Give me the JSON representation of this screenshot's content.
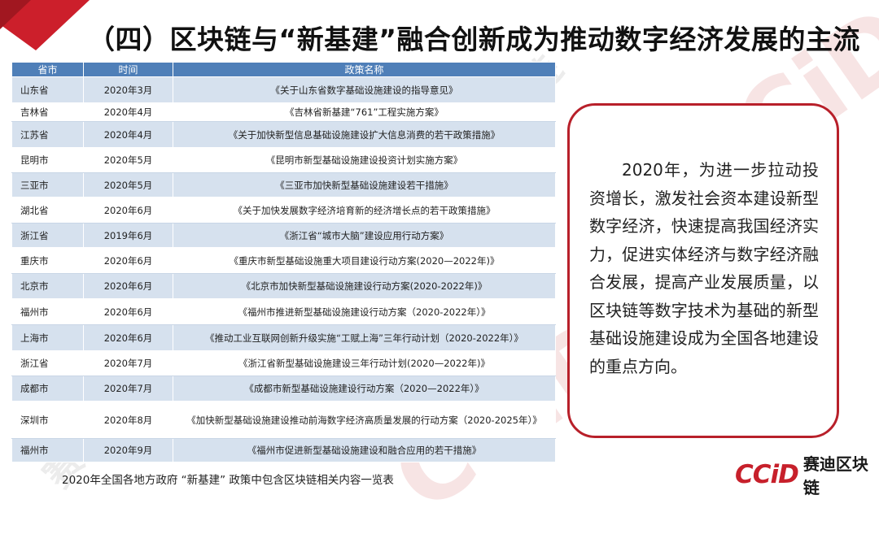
{
  "title": "（四）区块链与“新基建”融合创新成为推动数字经济发展的主流",
  "colors": {
    "accent": "#c7202b",
    "header": "#4f7fb8",
    "row_alt": "#d6e1ee"
  },
  "watermarks": {
    "logo": "CCiD",
    "text": "赛迪区块链"
  },
  "table": {
    "headers": [
      "省市",
      "时间",
      "政策名称"
    ],
    "rows": [
      {
        "region": "山东省",
        "date": "2020年3月",
        "policy": "《关于山东省数字基础设施建设的指导意见》"
      },
      {
        "region": "吉林省",
        "date": "2020年4月",
        "policy": "《吉林省新基建“761”工程实施方案》"
      },
      {
        "region": "江苏省",
        "date": "2020年4月",
        "policy": "《关于加快新型信息基础设施建设扩大信息消费的若干政策措施》"
      },
      {
        "region": "昆明市",
        "date": "2020年5月",
        "policy": "《昆明市新型基础设施建设投资计划实施方案》"
      },
      {
        "region": "三亚市",
        "date": "2020年5月",
        "policy": "《三亚市加快新型基础设施建设若干措施》"
      },
      {
        "region": "湖北省",
        "date": "2020年6月",
        "policy": "《关于加快发展数字经济培育新的经济增长点的若干政策措施》"
      },
      {
        "region": "浙江省",
        "date": "2019年6月",
        "policy": "《浙江省“城市大脑”建设应用行动方案》"
      },
      {
        "region": "重庆市",
        "date": "2020年6月",
        "policy": "《重庆市新型基础设施重大项目建设行动方案(2020—2022年)》"
      },
      {
        "region": "北京市",
        "date": "2020年6月",
        "policy": "《北京市加快新型基础设施建设行动方案(2020-2022年)》"
      },
      {
        "region": "福州市",
        "date": "2020年6月",
        "policy": "《福州市推进新型基础设施建设行动方案（2020-2022年）》"
      },
      {
        "region": "上海市",
        "date": "2020年6月",
        "policy": "《推动工业互联网创新升级实施“工赋上海”三年行动计划（2020-2022年）》"
      },
      {
        "region": "浙江省",
        "date": "2020年7月",
        "policy": "《浙江省新型基础设施建设三年行动计划(2020—2022年)》"
      },
      {
        "region": "成都市",
        "date": "2020年7月",
        "policy": "《成都市新型基础设施建设行动方案（2020—2022年）》"
      },
      {
        "region": "深圳市",
        "date": "2020年8月",
        "policy": "《加快新型基础设施建设推动前海数字经济高质量发展的行动方案（2020-2025年）》"
      },
      {
        "region": "福州市",
        "date": "2020年9月",
        "policy": "《福州市促进新型基础设施建设和融合应用的若干措施》"
      }
    ]
  },
  "caption": "2020年全国各地方政府 “新基建” 政策中包含区块链相关内容一览表",
  "note": "2020年，为进一步拉动投资增长，激发社会资本建设新型数字经济，快速提高我国经济实力，促进实体经济与数字经济融合发展，提高产业发展质量，以区块链等数字技术为基础的新型基础设施建设成为全国各地建设的重点方向。",
  "logo": {
    "mark": "CCiD",
    "name": "赛迪区块链"
  }
}
